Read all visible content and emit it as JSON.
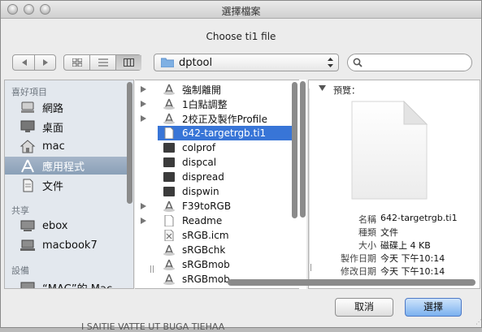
{
  "window": {
    "title": "選擇檔案",
    "prompt": "Choose ti1  file"
  },
  "toolbar": {
    "back_icon": "back-icon",
    "forward_icon": "forward-icon",
    "view_icons": [
      "icon-view-icon",
      "list-view-icon",
      "column-view-icon"
    ],
    "path": "dptool",
    "search_placeholder": ""
  },
  "sidebar": {
    "sections": [
      {
        "heading": "喜好項目",
        "items": [
          "網路",
          "桌面",
          "mac",
          "應用程式",
          "文件"
        ],
        "selected": "應用程式"
      },
      {
        "heading": "共享",
        "items": [
          "ebox",
          "macbook7"
        ]
      },
      {
        "heading": "設備",
        "items": [
          "“MAC”的 Mac"
        ]
      }
    ]
  },
  "file_list": {
    "items": [
      {
        "name": "強制離開",
        "type": "app",
        "expandable": true
      },
      {
        "name": "1白點調整",
        "type": "app",
        "expandable": true
      },
      {
        "name": "2校正及製作Profile",
        "type": "app",
        "expandable": true
      },
      {
        "name": "642-targetrgb.ti1",
        "type": "doc",
        "expandable": false,
        "selected": true
      },
      {
        "name": "colprof",
        "type": "exec",
        "expandable": false
      },
      {
        "name": "dispcal",
        "type": "exec",
        "expandable": false
      },
      {
        "name": "dispread",
        "type": "exec",
        "expandable": false
      },
      {
        "name": "dispwin",
        "type": "exec",
        "expandable": false
      },
      {
        "name": "F39toRGB",
        "type": "app",
        "expandable": true
      },
      {
        "name": "Readme",
        "type": "doc",
        "expandable": true
      },
      {
        "name": "sRGB.icm",
        "type": "icm",
        "expandable": false
      },
      {
        "name": "sRGBchk",
        "type": "app",
        "expandable": false
      },
      {
        "name": "sRGBmob",
        "type": "app",
        "expandable": false
      },
      {
        "name": "sRGBmob",
        "type": "app",
        "expandable": false
      }
    ]
  },
  "preview": {
    "label": "預覽：",
    "fields": [
      {
        "label": "名稱",
        "value": "642-targetrgb.ti1"
      },
      {
        "label": "種類",
        "value": "文件"
      },
      {
        "label": "大小",
        "value": "磁碟上 4 KB"
      },
      {
        "label": "製作日期",
        "value": "今天 下午10:14"
      },
      {
        "label": "修改日期",
        "value": "今天 下午10:14"
      }
    ]
  },
  "buttons": {
    "cancel": "取消",
    "choose": "選擇"
  },
  "background_text": "I SAITIE VATTE UT BUGA TIEHAA"
}
